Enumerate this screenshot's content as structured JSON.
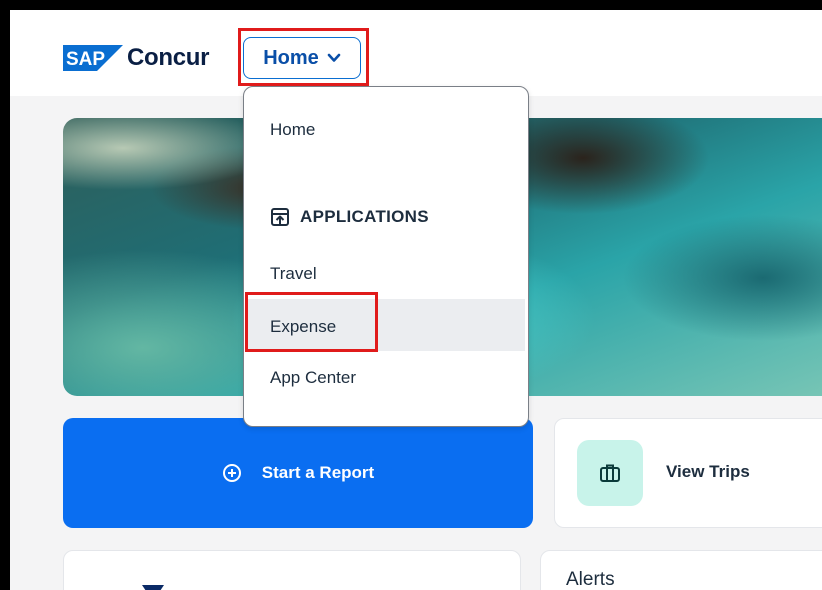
{
  "header": {
    "logo_brand": "SAP",
    "logo_product": "Concur",
    "nav_button_label": "Home"
  },
  "dropdown": {
    "items": [
      {
        "label": "Home"
      },
      {
        "label": "APPLICATIONS",
        "is_section_header": true,
        "icon": "app-launch-icon"
      },
      {
        "label": "Travel"
      },
      {
        "label": "Expense",
        "highlighted": true
      },
      {
        "label": "App Center"
      }
    ]
  },
  "tiles": {
    "start_report_label": "Start a Report",
    "view_trips_label": "View Trips",
    "alerts_label": "Alerts"
  },
  "colors": {
    "primary_blue": "#0a6ef1",
    "logo_blue": "#0a6ed1",
    "annotation_red": "#e01b1b",
    "trips_icon_bg": "#c8f3ea"
  }
}
